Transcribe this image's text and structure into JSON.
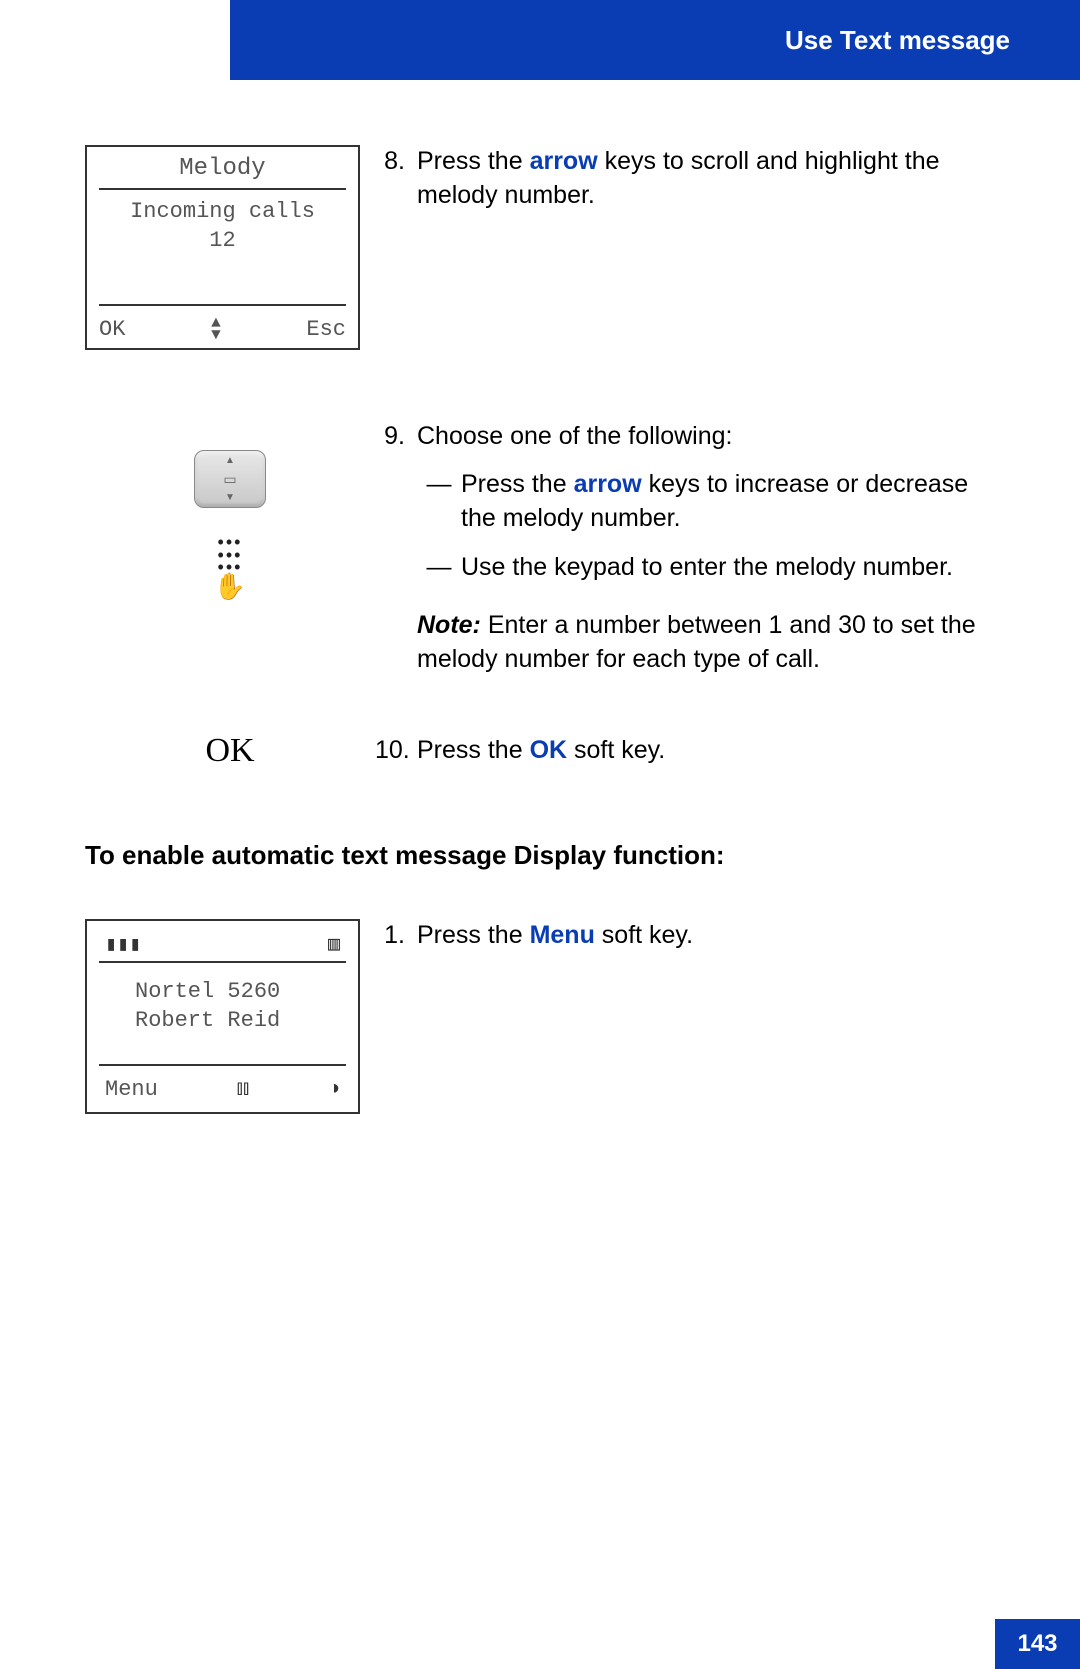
{
  "header": "Use Text message",
  "page_number": "143",
  "screen1": {
    "title": "Melody",
    "line1": "Incoming calls",
    "line2": "12",
    "left_soft": "OK",
    "right_soft": "Esc"
  },
  "step8": {
    "num": "8.",
    "pre": "Press the ",
    "key": "arrow",
    "post": " keys to scroll and highlight the melody number."
  },
  "step9": {
    "num": "9.",
    "intro": "Choose one of the following:",
    "opt1_pre": "Press the ",
    "opt1_key": "arrow",
    "opt1_post": " keys to increase or decrease the melody number.",
    "opt2": "Use the keypad to enter the melody number."
  },
  "note": {
    "label": "Note:",
    "text": " Enter a number between 1 and 30 to set the melody number for each type of call."
  },
  "ok_label": "OK",
  "step10": {
    "num": "10.",
    "pre": "Press the ",
    "key": "OK",
    "post": " soft key."
  },
  "section_heading": "To enable automatic text message Display function:",
  "screen2": {
    "line1": "Nortel 5260",
    "line2": "Robert Reid",
    "left_soft": "Menu"
  },
  "step1b": {
    "num": "1.",
    "pre": "Press the ",
    "key": "Menu",
    "post": " soft key."
  }
}
